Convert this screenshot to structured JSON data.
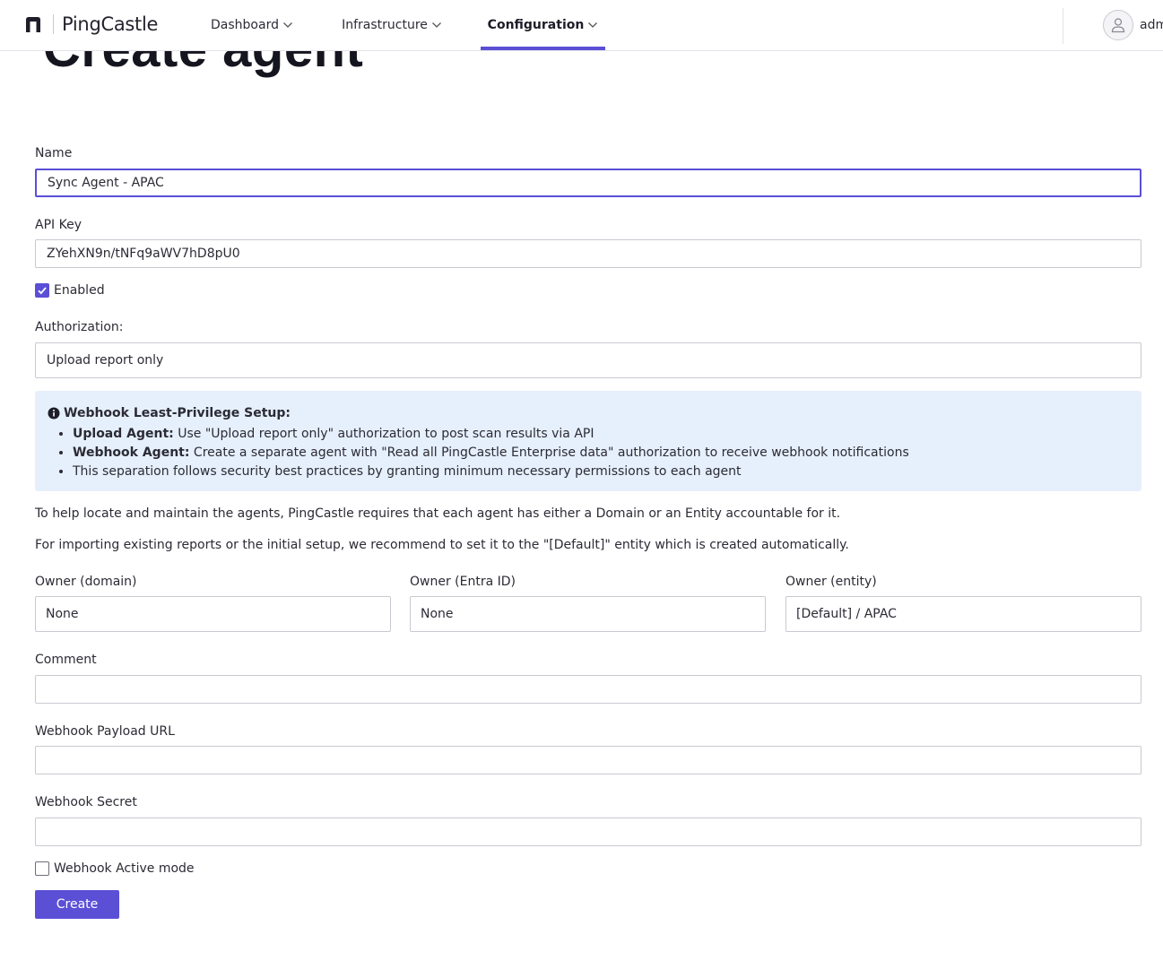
{
  "header": {
    "brand": "PingCastle",
    "nav": [
      {
        "label": "Dashboard"
      },
      {
        "label": "Infrastructure"
      },
      {
        "label": "Configuration"
      }
    ],
    "user": "adm"
  },
  "page": {
    "title": "Create agent"
  },
  "form": {
    "name": {
      "label": "Name",
      "value": "Sync Agent - APAC"
    },
    "api_key": {
      "label": "API Key",
      "value": "ZYehXN9n/tNFq9aWV7hD8pU0"
    },
    "enabled": {
      "label": "Enabled",
      "checked": true
    },
    "authorization": {
      "label": "Authorization:",
      "value": "Upload report only"
    },
    "info": {
      "title": "Webhook Least-Privilege Setup:",
      "items": [
        {
          "bold": "Upload Agent:",
          "text": " Use \"Upload report only\" authorization to post scan results via API"
        },
        {
          "bold": "Webhook Agent:",
          "text": " Create a separate agent with \"Read all PingCastle Enterprise data\" authorization to receive webhook notifications"
        },
        {
          "bold": "",
          "text": "This separation follows security best practices by granting minimum necessary permissions to each agent"
        }
      ]
    },
    "help_text_1": "To help locate and maintain the agents, PingCastle requires that each agent has either a Domain or an Entity accountable for it.",
    "help_text_2": "For importing existing reports or the initial setup, we recommend to set it to the \"[Default]\" entity which is created automatically.",
    "owner_domain": {
      "label": "Owner (domain)",
      "value": "None"
    },
    "owner_entra": {
      "label": "Owner (Entra ID)",
      "value": "None"
    },
    "owner_entity": {
      "label": "Owner (entity)",
      "value": "[Default] / APAC"
    },
    "comment": {
      "label": "Comment",
      "value": ""
    },
    "webhook_url": {
      "label": "Webhook Payload URL",
      "value": ""
    },
    "webhook_secret": {
      "label": "Webhook Secret",
      "value": ""
    },
    "webhook_active": {
      "label": "Webhook Active mode",
      "checked": false
    },
    "submit_label": "Create"
  },
  "colors": {
    "accent": "#5b4fd6",
    "info_background": "#e6f0fc"
  },
  "icons": [
    "pingcastle-logo-icon",
    "chevron-down-icon",
    "user-icon",
    "info-circle-icon",
    "checkmark-icon"
  ]
}
